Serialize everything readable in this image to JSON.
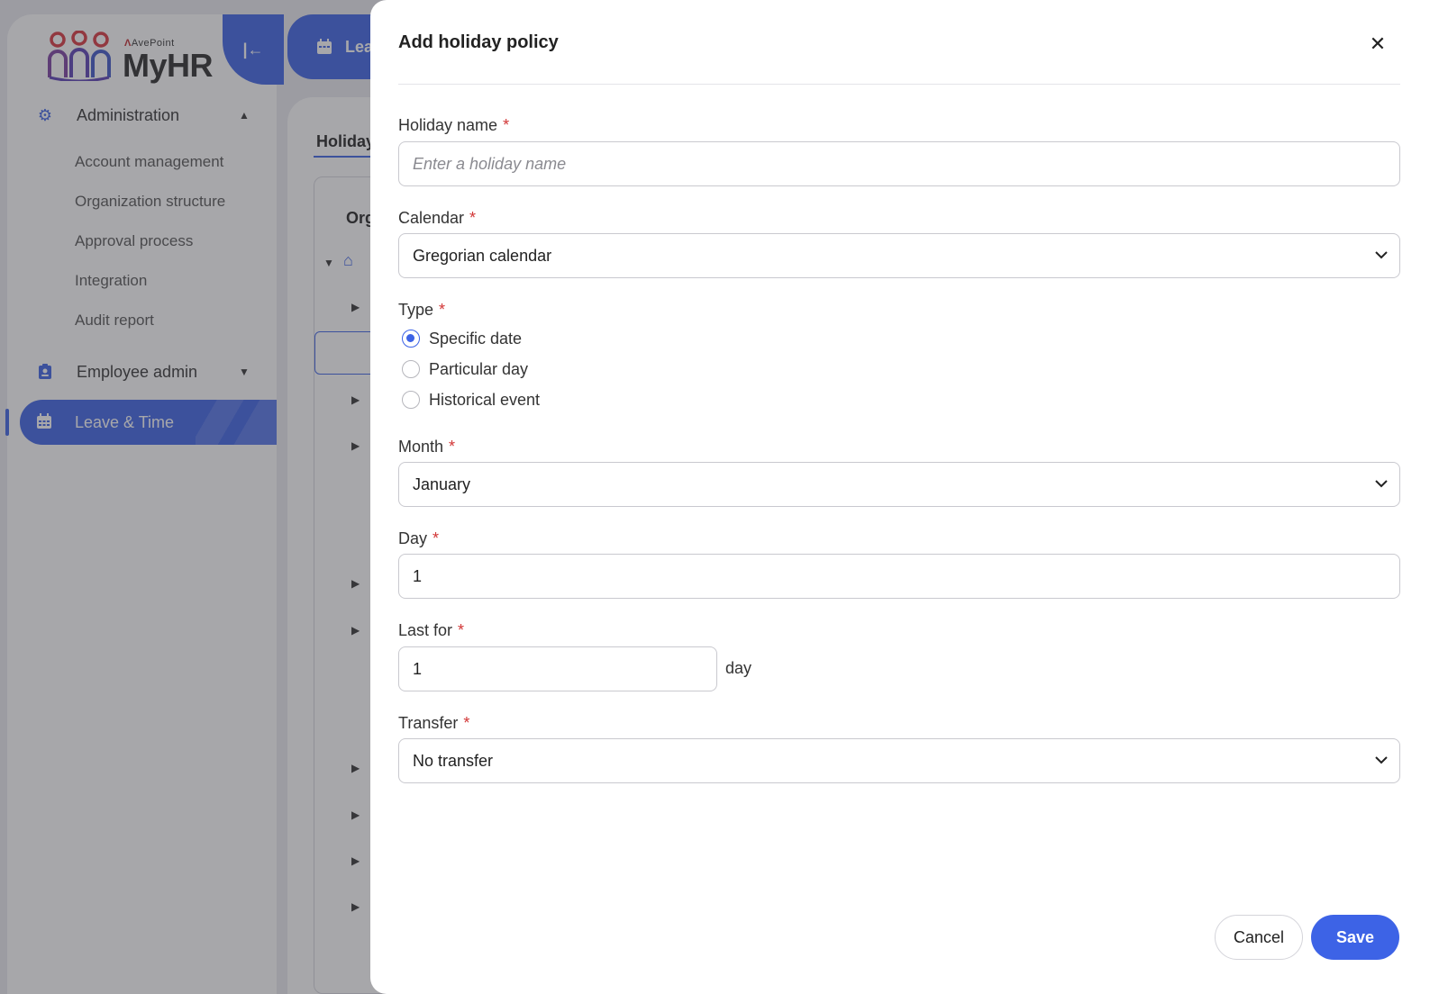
{
  "app": {
    "brand_company": "AvePoint",
    "brand_product": "MyHR",
    "accent_color": "#3d63e6"
  },
  "sidebar": {
    "groups": [
      {
        "label": "Administration",
        "icon": "gear-icon",
        "expanded": true,
        "items": [
          {
            "label": "Account management"
          },
          {
            "label": "Organization structure"
          },
          {
            "label": "Approval process"
          },
          {
            "label": "Integration"
          },
          {
            "label": "Audit report"
          }
        ]
      },
      {
        "label": "Employee admin",
        "icon": "id-badge-icon",
        "expanded": false
      },
      {
        "label": "Leave & Time",
        "icon": "calendar-icon",
        "active": true
      }
    ]
  },
  "header": {
    "tab_label": "Lea"
  },
  "main": {
    "tab_label": "Holiday",
    "section_label": "Org"
  },
  "drawer": {
    "title": "Add holiday policy",
    "required_marker": "*",
    "fields": {
      "holiday_name": {
        "label": "Holiday name",
        "value": "",
        "placeholder": "Enter a holiday name"
      },
      "calendar": {
        "label": "Calendar",
        "value": "Gregorian calendar"
      },
      "type": {
        "label": "Type",
        "options": [
          {
            "label": "Specific date",
            "checked": true
          },
          {
            "label": "Particular day",
            "checked": false
          },
          {
            "label": "Historical event",
            "checked": false
          }
        ]
      },
      "month": {
        "label": "Month",
        "value": "January"
      },
      "day": {
        "label": "Day",
        "value": "1"
      },
      "last_for": {
        "label": "Last for",
        "value": "1",
        "unit": "day"
      },
      "transfer": {
        "label": "Transfer",
        "value": "No transfer"
      }
    },
    "actions": {
      "cancel_label": "Cancel",
      "save_label": "Save"
    }
  }
}
